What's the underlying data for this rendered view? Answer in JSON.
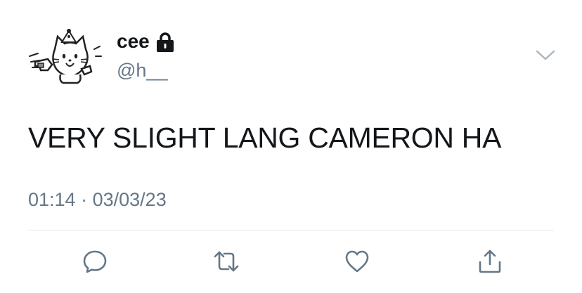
{
  "user": {
    "display_name": "cee",
    "handle": "@h__",
    "protected": true
  },
  "tweet": {
    "text": "VERY SLIGHT LANG CAMERON HA",
    "time": "01:14",
    "separator": "·",
    "date": "03/03/23"
  },
  "icons": {
    "avatar": "cartoon-cat-avatar",
    "lock": "lock-icon",
    "menu": "chevron-down-icon",
    "reply": "reply-icon",
    "retweet": "retweet-icon",
    "like": "heart-icon",
    "share": "share-icon"
  },
  "colors": {
    "text_primary": "#14171a",
    "text_secondary": "#657786",
    "divider": "#e1e8ed",
    "action_icon": "#657786"
  }
}
